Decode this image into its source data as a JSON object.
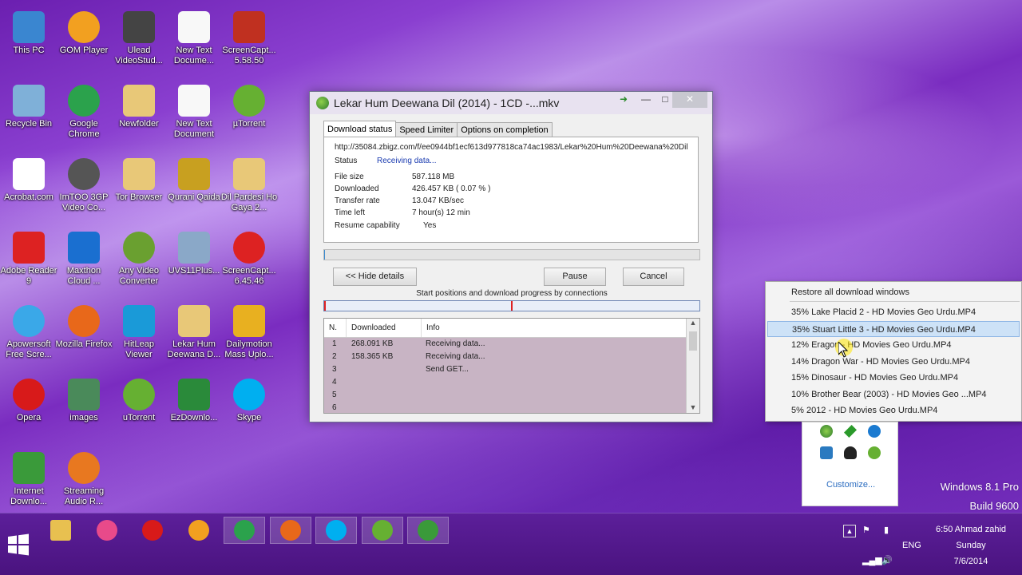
{
  "desktop_icons": [
    {
      "label": "This PC",
      "icon": "computer-icon",
      "color": "#3a86d0"
    },
    {
      "label": "GOM Player",
      "icon": "gom-player-icon",
      "color": "#f2a020"
    },
    {
      "label": "Ulead VideoStud...",
      "icon": "ulead-icon",
      "color": "#444"
    },
    {
      "label": "New Text Docume...",
      "icon": "text-document-icon",
      "color": "#f8f8f8"
    },
    {
      "label": "ScreenCapt... 5.58.50",
      "icon": "screencapture-icon",
      "color": "#c03020"
    },
    {
      "label": "Recycle Bin",
      "icon": "recycle-bin-icon",
      "color": "#7fb0d8"
    },
    {
      "label": "Google Chrome",
      "icon": "chrome-icon",
      "color": "#2ba24c"
    },
    {
      "label": "Newfolder",
      "icon": "folder-icon",
      "color": "#e8c878"
    },
    {
      "label": "New Text Document",
      "icon": "text-document-icon",
      "color": "#f8f8f8"
    },
    {
      "label": "µTorrent",
      "icon": "utorrent-icon",
      "color": "#66b032"
    },
    {
      "label": "Acrobat.com",
      "icon": "acrobat-icon",
      "color": "#ffffff"
    },
    {
      "label": "ImTOO 3GP Video Co...",
      "icon": "film-reel-icon",
      "color": "#555"
    },
    {
      "label": "Tor Browser",
      "icon": "folder-icon",
      "color": "#e8c878"
    },
    {
      "label": "Qurani Qaida",
      "icon": "qaida-icon",
      "color": "#c8a020"
    },
    {
      "label": "Dil Pardesi Ho Gaya 2...",
      "icon": "folder-icon",
      "color": "#e8c878"
    },
    {
      "label": "Adobe Reader 9",
      "icon": "adobe-reader-icon",
      "color": "#d22"
    },
    {
      "label": "Maxthon Cloud ...",
      "icon": "maxthon-icon",
      "color": "#1a6fd0"
    },
    {
      "label": "Any Video Converter",
      "icon": "video-converter-icon",
      "color": "#6aa030"
    },
    {
      "label": "UVS11Plus...",
      "icon": "uvs-icon",
      "color": "#8aa8c8"
    },
    {
      "label": "ScreenCapt... 6.45.46",
      "icon": "wmv-icon",
      "color": "#d22"
    },
    {
      "label": "Apowersoft Free Scre...",
      "icon": "apowersoft-icon",
      "color": "#3aa8e8"
    },
    {
      "label": "Mozilla Firefox",
      "icon": "firefox-icon",
      "color": "#e8681a"
    },
    {
      "label": "HitLeap Viewer",
      "icon": "hitleap-icon",
      "color": "#1a9ad8"
    },
    {
      "label": "Lekar Hum Deewana D...",
      "icon": "folder-icon",
      "color": "#e8c878"
    },
    {
      "label": "Dailymotion Mass Uplo...",
      "icon": "dailymotion-icon",
      "color": "#e8b020"
    },
    {
      "label": "Opera",
      "icon": "opera-icon",
      "color": "#d81a1a"
    },
    {
      "label": "images",
      "icon": "images-icon",
      "color": "#4a8a5a"
    },
    {
      "label": "uTorrent",
      "icon": "utorrent-icon",
      "color": "#66b032"
    },
    {
      "label": "EzDownlo...",
      "icon": "ezdownload-icon",
      "color": "#2a8a3a"
    },
    {
      "label": "Skype",
      "icon": "skype-icon",
      "color": "#00aff0"
    },
    {
      "label": "Internet Downlo...",
      "icon": "idm-icon",
      "color": "#3a9a3a"
    },
    {
      "label": "Streaming Audio R...",
      "icon": "streaming-audio-icon",
      "color": "#e87820"
    }
  ],
  "download_window": {
    "title": "Lekar Hum Deewana Dil (2014) - 1CD -...mkv",
    "tabs": [
      "Download status",
      "Speed Limiter",
      "Options on completion"
    ],
    "url": "http://35084.zbigz.com/f/ee0944bf1ecf613d977818ca74ac1983/Lekar%20Hum%20Deewana%20Dil",
    "status_label": "Status",
    "status_value": "Receiving data...",
    "file_size_label": "File size",
    "file_size_value": "587.118  MB",
    "downloaded_label": "Downloaded",
    "downloaded_value": "426.457  KB  ( 0.07 % )",
    "transfer_rate_label": "Transfer rate",
    "transfer_rate_value": "13.047  KB/sec",
    "time_left_label": "Time left",
    "time_left_value": "7 hour(s) 12 min",
    "resume_label": "Resume capability",
    "resume_value": "Yes",
    "progress_percent": 0.07,
    "hide_details_label": "<< Hide details",
    "pause_label": "Pause",
    "cancel_label": "Cancel",
    "connections_label": "Start positions and download progress by connections",
    "table_headers": [
      "N.",
      "Downloaded",
      "Info"
    ],
    "rows": [
      {
        "n": "1",
        "downloaded": "268.091  KB",
        "info": "Receiving data..."
      },
      {
        "n": "2",
        "downloaded": "158.365  KB",
        "info": "Receiving data..."
      },
      {
        "n": "3",
        "downloaded": "",
        "info": "Send GET..."
      },
      {
        "n": "4",
        "downloaded": "",
        "info": ""
      },
      {
        "n": "5",
        "downloaded": "",
        "info": ""
      },
      {
        "n": "6",
        "downloaded": "",
        "info": ""
      }
    ]
  },
  "tray_menu": {
    "restore_label": "Restore all download windows",
    "items": [
      "35% Lake Placid 2 - HD Movies Geo Urdu.MP4",
      "35% Stuart Little 3 - HD Movies Geo Urdu.MP4",
      "12% Eragon - HD Movies Geo Urdu.MP4",
      "14% Dragon War - HD Movies Geo Urdu.MP4",
      "15% Dinosaur - HD Movies Geo Urdu.MP4",
      "10% Brother Bear (2003) - HD Movies Geo ...MP4",
      "5% 2012 - HD Movies Geo Urdu.MP4"
    ],
    "highlighted_index": 1
  },
  "tray_overflow": {
    "customize_label": "Customize..."
  },
  "watermark": {
    "edition": "Windows 8.1 Pro",
    "build": "Build 9600"
  },
  "taskbar": {
    "apps": [
      "file-explorer-icon",
      "picasa-icon",
      "opera-icon",
      "gom-player-icon",
      "chrome-icon",
      "firefox-icon",
      "skype-icon",
      "utorrent-icon",
      "idm-icon"
    ],
    "language": "ENG",
    "time_user": "6:50 Ahmad zahid",
    "day": "Sunday",
    "date": "7/6/2014"
  }
}
